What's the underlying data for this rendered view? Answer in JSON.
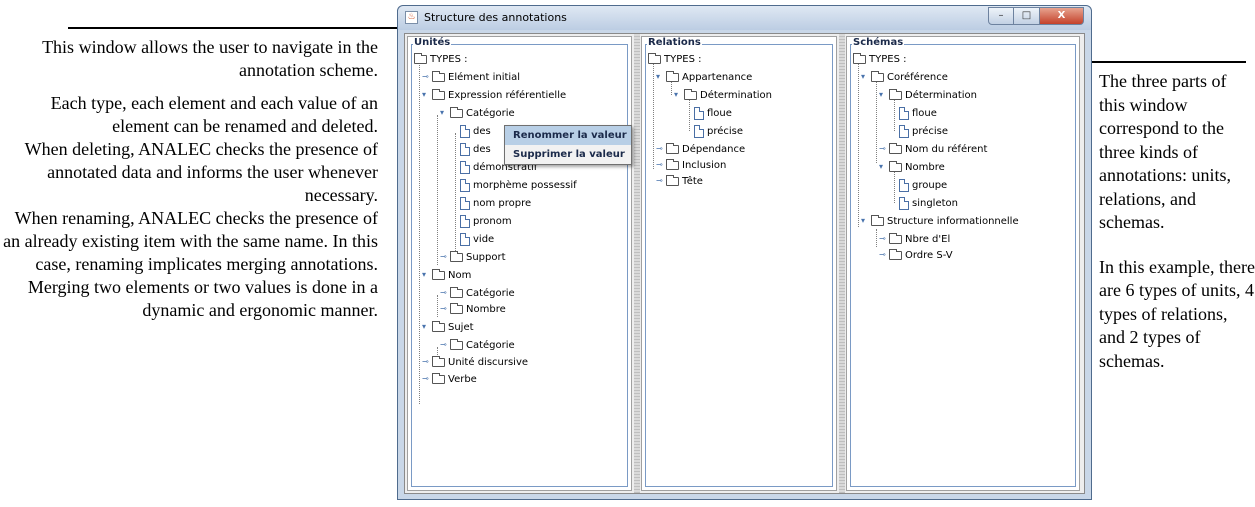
{
  "left_caption": {
    "p1": "This window allows the user to navigate in the annotation scheme.",
    "p2": "Each type, each element and each value of an element can be renamed and deleted.",
    "p3": "When deleting, ANALEC checks the presence of annotated data and informs the user whenever necessary.",
    "p4": "When renaming, ANALEC checks the presence of an already existing item with the same name. In this case, renaming implicates merging annotations. Merging two elements or two values is done in a dynamic and ergonomic manner."
  },
  "right_caption": {
    "p1": "The three parts of this window correspond to the three kinds of annotations: units, relations, and schemas.",
    "p2": "In this example, there are 6 types of units, 4 types of relations, and 2 types of schemas."
  },
  "window": {
    "title": "Structure des annotations",
    "app_icon": "java-icon",
    "minimize_glyph": "–",
    "maximize_glyph": "□",
    "close_glyph": "X"
  },
  "panes": {
    "units": {
      "title": "Unités",
      "items": [
        "TYPES :",
        "Elément initial",
        "Expression référentielle",
        "Catégorie",
        "des",
        "des",
        "démonstratif",
        "morphème possessif",
        "nom propre",
        "pronom",
        "vide",
        "Support",
        "Nom",
        "Catégorie",
        "Nombre",
        "Sujet",
        "Catégorie",
        "Unité discursive",
        "Verbe"
      ]
    },
    "relations": {
      "title": "Relations",
      "items": [
        "TYPES :",
        "Appartenance",
        "Détermination",
        "floue",
        "précise",
        "Dépendance",
        "Inclusion",
        "Tête"
      ]
    },
    "schemas": {
      "title": "Schémas",
      "items": [
        "TYPES :",
        "Coréférence",
        "Détermination",
        "floue",
        "précise",
        "Nom du référent",
        "Nombre",
        "groupe",
        "singleton",
        "Structure informationnelle",
        "Nbre d'El",
        "Ordre S-V"
      ]
    }
  },
  "context_menu": {
    "rename": "Renommer la valeur",
    "delete": "Supprimer la valeur"
  },
  "icons": {
    "expanded": "▾",
    "collapsed": "⊸"
  },
  "colors": {
    "window_frame": "#c9d7e8",
    "menu_highlight": "#b8cfe6",
    "close_button": "#c4412a"
  }
}
